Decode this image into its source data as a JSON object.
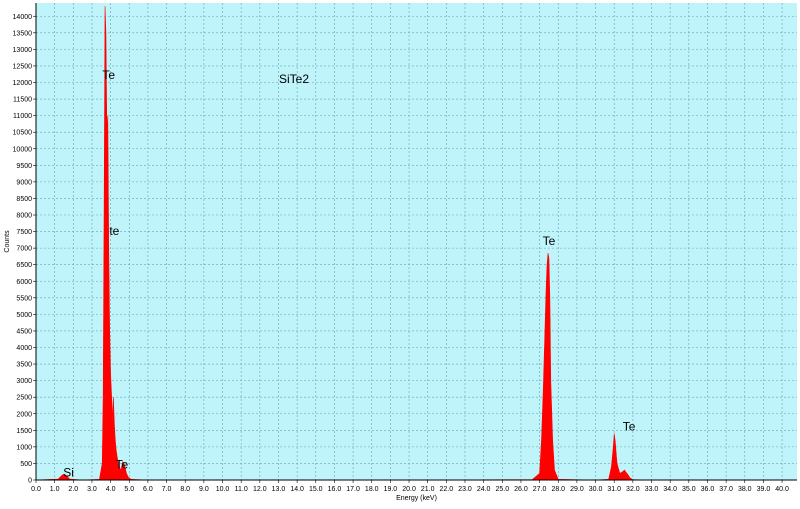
{
  "chart_data": {
    "type": "area",
    "title": "SiTe2",
    "xlabel": "Energy (keV)",
    "ylabel": "Counts",
    "xlim": [
      0,
      40.8
    ],
    "ylim": [
      0,
      14400
    ],
    "x_ticks": [
      0.0,
      1.0,
      2.0,
      3.0,
      4.0,
      5.0,
      6.0,
      7.0,
      8.0,
      9.0,
      10.0,
      11.0,
      12.0,
      13.0,
      14.0,
      15.0,
      16.0,
      17.0,
      18.0,
      19.0,
      20.0,
      21.0,
      22.0,
      23.0,
      24.0,
      25.0,
      26.0,
      27.0,
      28.0,
      29.0,
      30.0,
      31.0,
      32.0,
      33.0,
      34.0,
      35.0,
      36.0,
      37.0,
      38.0,
      39.0,
      40.0
    ],
    "y_ticks": [
      0,
      500,
      1000,
      1500,
      2000,
      2500,
      3000,
      3500,
      4000,
      4500,
      5000,
      5500,
      6000,
      6500,
      7000,
      7500,
      8000,
      8500,
      9000,
      9500,
      10000,
      10500,
      11000,
      11500,
      12000,
      12500,
      13000,
      13500,
      14000
    ],
    "grid": true,
    "background_color": "#bff5fa",
    "series_color": "#ff0000",
    "series": [
      {
        "x": [
          0.0,
          1.2,
          1.35,
          1.5,
          1.65,
          1.8,
          2.5,
          3.4,
          3.55,
          3.6,
          3.65,
          3.7,
          3.75,
          3.8,
          3.85,
          3.9,
          3.95,
          4.0,
          4.05,
          4.1,
          4.15,
          4.2,
          4.25,
          4.3,
          4.35,
          4.45,
          4.55,
          4.65,
          4.7,
          4.75,
          4.85,
          4.95,
          5.1,
          6.0,
          10.0,
          20.0,
          26.6,
          27.0,
          27.1,
          27.2,
          27.3,
          27.35,
          27.4,
          27.45,
          27.5,
          27.55,
          27.6,
          27.7,
          27.8,
          28.0,
          30.0,
          30.7,
          30.85,
          30.95,
          31.0,
          31.05,
          31.15,
          31.3,
          31.45,
          31.55,
          31.65,
          31.75,
          31.85,
          32.0,
          33.0,
          40.8
        ],
        "y": [
          0,
          30,
          120,
          180,
          120,
          30,
          0,
          20,
          500,
          2500,
          8000,
          14300,
          13500,
          10500,
          11000,
          7000,
          4500,
          3200,
          2600,
          1800,
          2500,
          1700,
          1200,
          900,
          700,
          400,
          300,
          550,
          500,
          450,
          200,
          80,
          20,
          0,
          0,
          0,
          10,
          200,
          1200,
          2800,
          4800,
          5800,
          6500,
          6850,
          6700,
          5500,
          3000,
          1200,
          300,
          20,
          0,
          20,
          400,
          1000,
          1400,
          1200,
          500,
          200,
          250,
          300,
          220,
          150,
          60,
          10,
          0,
          0
        ]
      }
    ],
    "annotations": [
      {
        "text": "Te",
        "x": 3.9,
        "y": 12100
      },
      {
        "text": "te",
        "x": 4.2,
        "y": 7400
      },
      {
        "text": "Te",
        "x": 4.6,
        "y": 350
      },
      {
        "text": "Si",
        "x": 1.75,
        "y": 100
      },
      {
        "text": "Te",
        "x": 27.5,
        "y": 7100
      },
      {
        "text": "Te",
        "x": 31.8,
        "y": 1500
      }
    ]
  }
}
